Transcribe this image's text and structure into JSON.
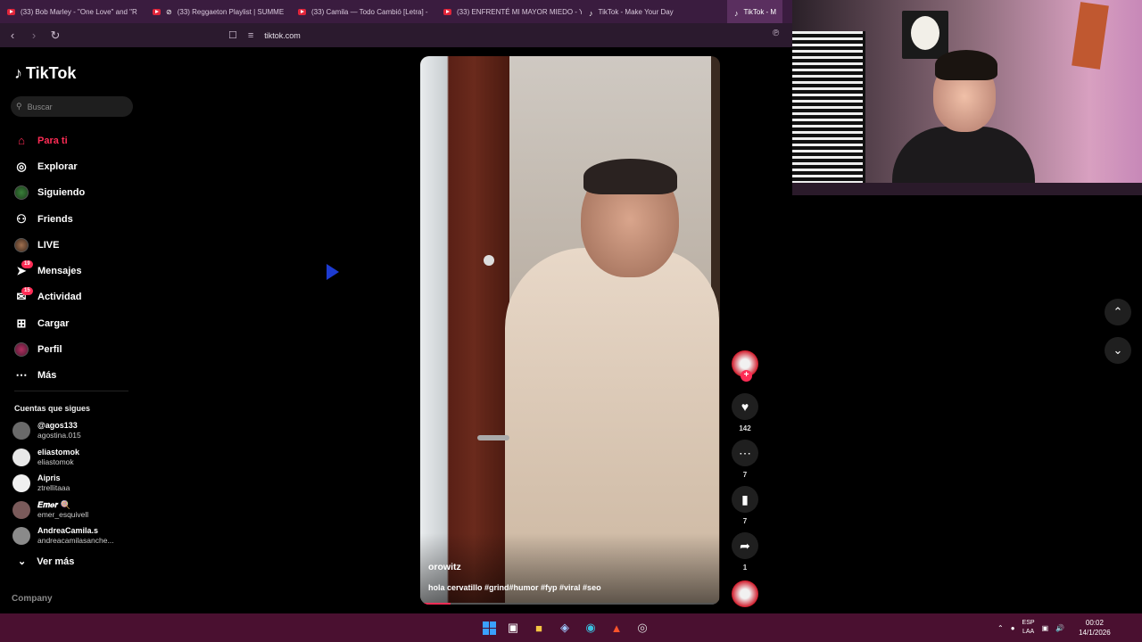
{
  "browser": {
    "tabs": [
      {
        "title": "(33) Bob Marley - \"One Love\" and \"R",
        "icon": "youtube-icon",
        "active": false,
        "muted": false
      },
      {
        "title": "(33) Reggaeton Playlist | SUMME",
        "icon": "youtube-icon",
        "active": false,
        "muted": true
      },
      {
        "title": "(33) Camila — Todo Cambió [Letra] -",
        "icon": "youtube-icon",
        "active": false,
        "muted": false
      },
      {
        "title": "(33) ENFRENTÉ MI MAYOR MIEDO - Y",
        "icon": "youtube-icon",
        "active": false,
        "muted": false
      },
      {
        "title": "TikTok - Make Your Day",
        "icon": "tiktok-icon",
        "active": false,
        "muted": false
      },
      {
        "title": "TikTok - M",
        "icon": "tiktok-icon",
        "active": true,
        "muted": false
      }
    ],
    "url": "tiktok.com"
  },
  "sidebar": {
    "logo_text": "TikTok",
    "search_placeholder": "Buscar",
    "nav": [
      {
        "label": "Para ti",
        "icon": "home-icon",
        "active": true
      },
      {
        "label": "Explorar",
        "icon": "compass-icon",
        "active": false
      },
      {
        "label": "Siguiendo",
        "icon": "avatar",
        "active": false
      },
      {
        "label": "Friends",
        "icon": "friends-icon",
        "active": false
      },
      {
        "label": "LIVE",
        "icon": "avatar",
        "active": false
      },
      {
        "label": "Mensajes",
        "icon": "send-icon",
        "badge": "19",
        "active": false
      },
      {
        "label": "Actividad",
        "icon": "inbox-icon",
        "badge": "15",
        "active": false
      },
      {
        "label": "Cargar",
        "icon": "plus-box-icon",
        "active": false
      },
      {
        "label": "Perfil",
        "icon": "avatar",
        "active": false
      },
      {
        "label": "Más",
        "icon": "more-icon",
        "active": false
      }
    ],
    "following_title": "Cuentas que sigues",
    "following": [
      {
        "handle": "@agos133",
        "sub": "agostina.015"
      },
      {
        "handle": "eliastomok",
        "sub": "eliastomok"
      },
      {
        "handle": "Aipris",
        "sub": "ztrellitaaa"
      },
      {
        "handle": "𝑬𝒎𝒆𝒓 🍭",
        "sub": "emer_esquivell"
      },
      {
        "handle": "AndreaCamila.s",
        "sub": "andreacamilasanche..."
      }
    ],
    "see_more": "Ver más",
    "company": "Company"
  },
  "video": {
    "author": "orowitz",
    "caption": "hola cervatillo #grind#humor  #fyp #viral #seo",
    "progress": 0.1
  },
  "actions": {
    "likes": "142",
    "comments": "7",
    "saves": "7",
    "shares": "1"
  },
  "taskbar": {
    "lang": "ESP",
    "lang_sub": "LAA",
    "time": "00:02",
    "date": "14/1/2026"
  }
}
